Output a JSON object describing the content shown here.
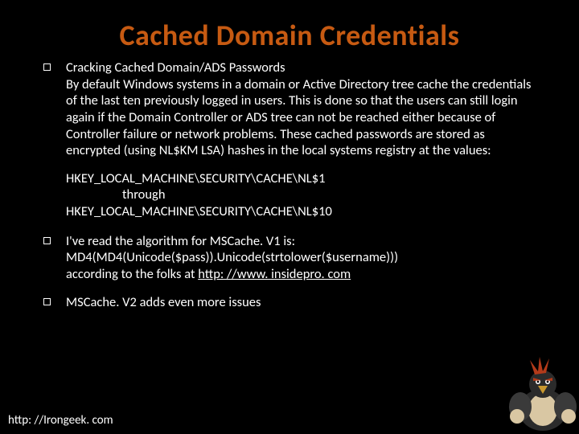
{
  "title": "Cached Domain Credentials",
  "bullets": {
    "b1_heading": "Cracking Cached Domain/ADS Passwords",
    "b1_body": "By default Windows  systems in a domain or Active Directory tree cache the credentials of the last ten previously logged in users. This is done so that the users can still login again if the Domain Controller or ADS tree can not be reached either because of Controller failure or network problems. These cached passwords are stored as encrypted (using NL$KM LSA) hashes in the local systems registry at the values:",
    "reg1": "HKEY_LOCAL_MACHINE\\SECURITY\\CACHE\\NL$1",
    "reg_through": "through",
    "reg2": "HKEY_LOCAL_MACHINE\\SECURITY\\CACHE\\NL$10",
    "b2_line1": "I've read the algorithm for MSCache. V1 is:",
    "b2_line2": "MD4(MD4(Unicode($pass)).Unicode(strtolower($username)))",
    "b2_line3_prefix": "according to the folks at ",
    "b2_link": "http: //www. insidepro. com",
    "b3": "MSCache. V2 adds even more issues"
  },
  "footer": "http: //Irongeek. com",
  "mascot_name": "bird-muscle-mascot"
}
